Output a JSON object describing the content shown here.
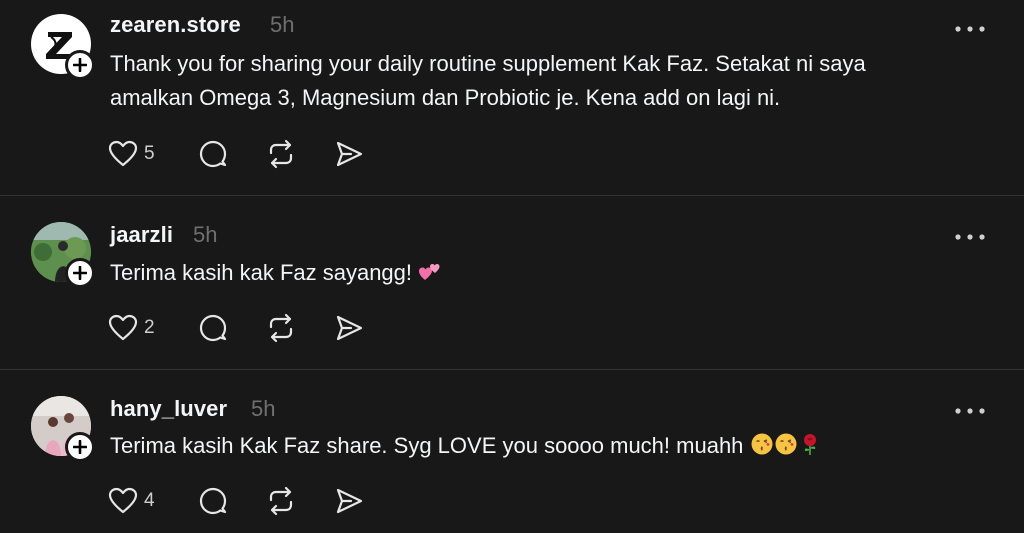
{
  "posts": [
    {
      "username": "zearen.store",
      "time": "5h",
      "avatar_letter": "Z",
      "avatar_color": "#ffffff",
      "text_line1": "Thank you for sharing your daily routine supplement Kak Faz. Setakat ni saya",
      "text_line2": "amalkan Omega 3, Magnesium dan Probiotic je. Kena add on lagi ni.",
      "likes": "5"
    },
    {
      "username": "jaarzli",
      "time": "5h",
      "avatar_color": "#4c7d46",
      "text": "Terima kasih kak Faz sayangg!",
      "emojis": [
        "two-hearts"
      ],
      "likes": "2"
    },
    {
      "username": "hany_luver",
      "time": "5h",
      "avatar_color": "#d9d3d0",
      "text": "Terima kasih Kak Faz share. Syg LOVE you soooo much! muahh",
      "emojis": [
        "kissing-face",
        "kissing-face",
        "rose"
      ],
      "likes": "4"
    }
  ],
  "colors": {
    "background": "#181818",
    "text": "#f3f5f7",
    "muted": "#6f6f6f",
    "divider": "#323232"
  },
  "icons": [
    "heart-icon",
    "comment-icon",
    "repost-icon",
    "share-icon",
    "more-icon",
    "follow-plus-icon"
  ]
}
